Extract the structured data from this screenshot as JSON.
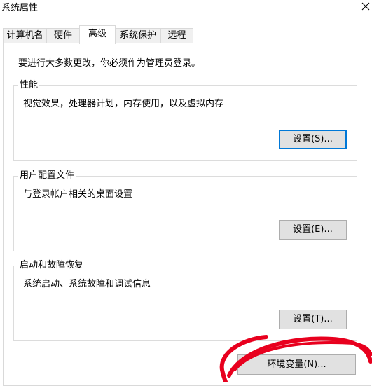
{
  "window": {
    "title": "系统属性",
    "close_icon": "close-icon"
  },
  "tabs": [
    {
      "label": "计算机名",
      "active": false
    },
    {
      "label": "硬件",
      "active": false
    },
    {
      "label": "高级",
      "active": true
    },
    {
      "label": "系统保护",
      "active": false
    },
    {
      "label": "远程",
      "active": false
    }
  ],
  "panel": {
    "intro": "要进行大多数更改，你必须作为管理员登录。",
    "groups": [
      {
        "label": "性能",
        "description": "视觉效果，处理器计划，内存使用，以及虚拟内存",
        "button": "设置(S)..."
      },
      {
        "label": "用户配置文件",
        "description": "与登录帐户相关的桌面设置",
        "button": "设置(E)..."
      },
      {
        "label": "启动和故障恢复",
        "description": "系统启动、系统故障和调试信息",
        "button": "设置(T)..."
      }
    ],
    "env_button": "环境变量(N)..."
  },
  "colors": {
    "focus_border": "#0078d7",
    "button_bg": "#e1e1e1",
    "annotation": "#e8001e"
  }
}
